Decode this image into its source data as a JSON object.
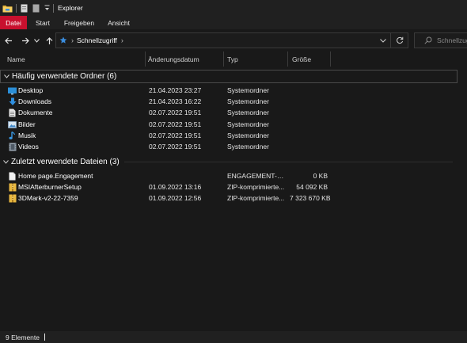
{
  "window": {
    "title": "Explorer"
  },
  "ribbon": {
    "tabs": [
      {
        "label": "Datei"
      },
      {
        "label": "Start"
      },
      {
        "label": "Freigeben"
      },
      {
        "label": "Ansicht"
      }
    ]
  },
  "address": {
    "location": "Schnellzugriff",
    "search_placeholder": "Schnellzugriff durchsuchen"
  },
  "columns": {
    "name": "Name",
    "date": "Änderungsdatum",
    "type": "Typ",
    "size": "Größe"
  },
  "groups": [
    {
      "title": "Häufig verwendete Ordner (6)",
      "items": [
        {
          "name": "Desktop",
          "date": "21.04.2023 23:27",
          "type": "Systemordner",
          "size": "",
          "icon": "desktop-folder-icon"
        },
        {
          "name": "Downloads",
          "date": "21.04.2023 16:22",
          "type": "Systemordner",
          "size": "",
          "icon": "downloads-folder-icon"
        },
        {
          "name": "Dokumente",
          "date": "02.07.2022 19:51",
          "type": "Systemordner",
          "size": "",
          "icon": "documents-folder-icon"
        },
        {
          "name": "Bilder",
          "date": "02.07.2022 19:51",
          "type": "Systemordner",
          "size": "",
          "icon": "pictures-folder-icon"
        },
        {
          "name": "Musik",
          "date": "02.07.2022 19:51",
          "type": "Systemordner",
          "size": "",
          "icon": "music-folder-icon"
        },
        {
          "name": "Videos",
          "date": "02.07.2022 19:51",
          "type": "Systemordner",
          "size": "",
          "icon": "videos-folder-icon"
        }
      ]
    },
    {
      "title": "Zuletzt verwendete Dateien (3)",
      "items": [
        {
          "name": "Home page.Engagement",
          "date": "",
          "type": "ENGAGEMENT-Da...",
          "size": "0 KB",
          "icon": "blank-file-icon"
        },
        {
          "name": "MSIAfterburnerSetup",
          "date": "01.09.2022 13:16",
          "type": "ZIP-komprimierte...",
          "size": "54 092 KB",
          "icon": "zip-file-icon"
        },
        {
          "name": "3DMark-v2-22-7359",
          "date": "01.09.2022 12:56",
          "type": "ZIP-komprimierte...",
          "size": "7 323 670 KB",
          "icon": "zip-file-icon"
        }
      ]
    }
  ],
  "status": {
    "count": "9 Elemente"
  },
  "colors": {
    "file_tab": "#c8102e",
    "background": "#191919",
    "chrome": "#202020",
    "quick_access_star": "#3a8dde"
  }
}
